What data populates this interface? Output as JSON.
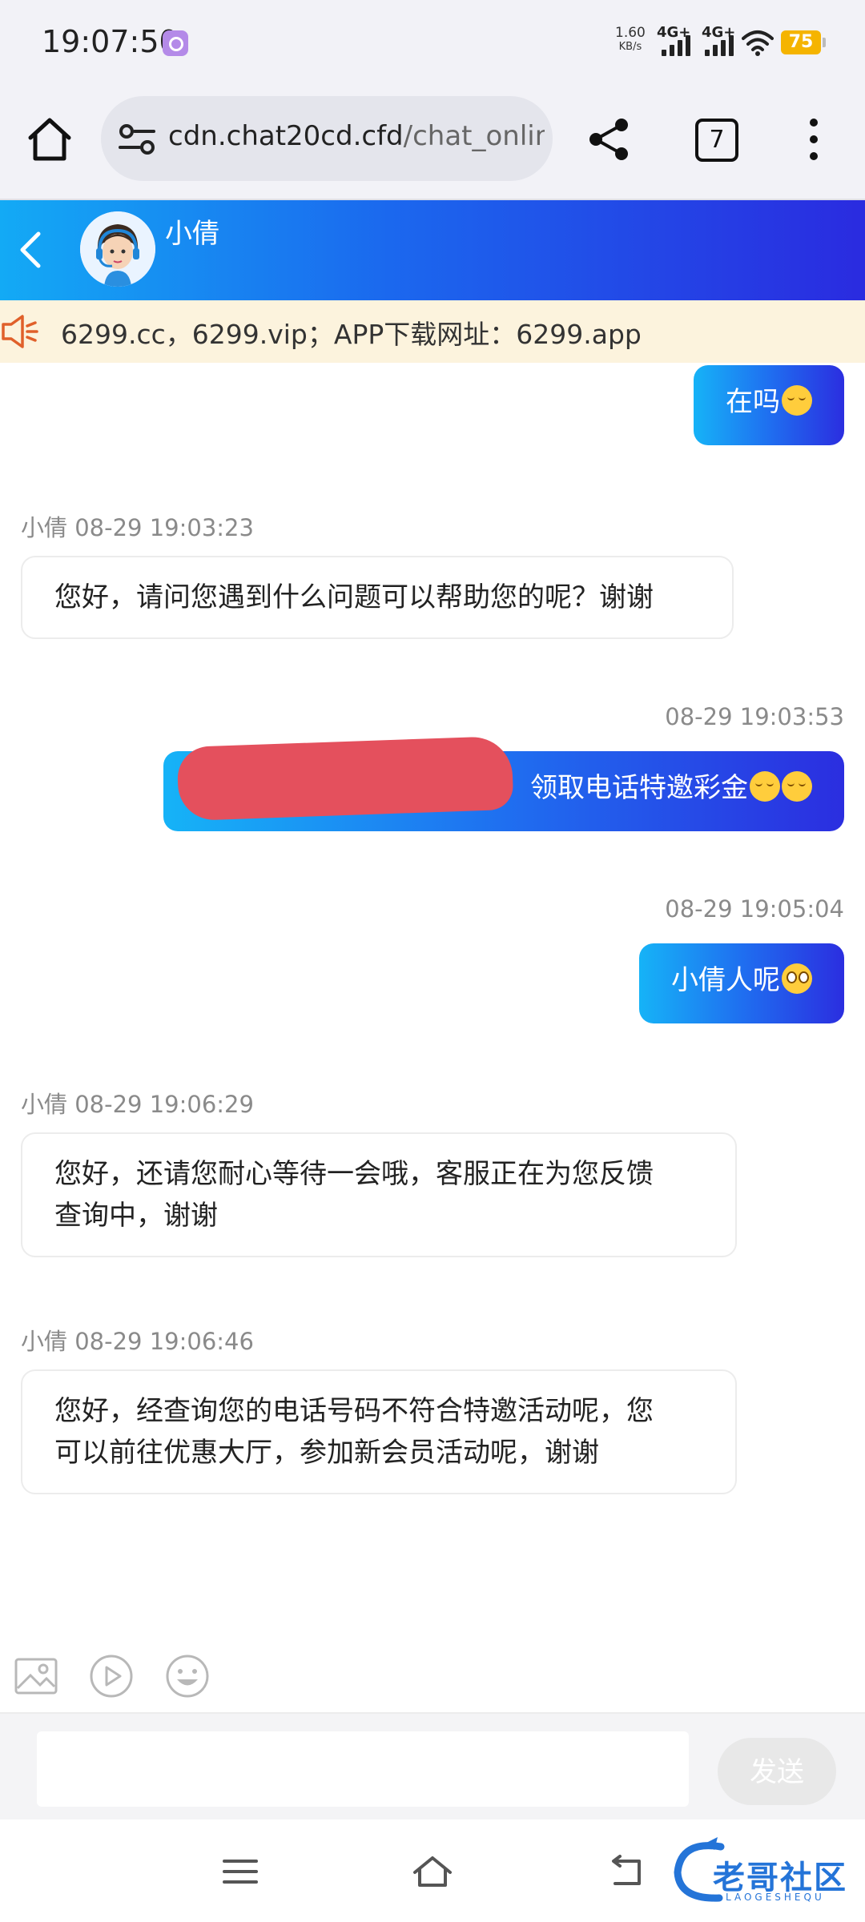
{
  "status_bar": {
    "time": "19:07:50",
    "speed_value": "1.60",
    "speed_unit": "KB/s",
    "net1": "4G+",
    "net2": "4G+",
    "battery": "75"
  },
  "browser": {
    "url_host": "cdn.chat20cd.cfd",
    "url_path": "/chat_online",
    "tab_count": "7"
  },
  "chat": {
    "agent_name": "小倩",
    "notice": "6299.cc，6299.vip；APP下载网址：6299.app",
    "messages": [
      {
        "dir": "out",
        "text": "在吗",
        "emoji": "relieved-face"
      },
      {
        "dir": "in",
        "meta": "小倩 08-29 19:03:23",
        "text": "您好，请问您遇到什么问题可以帮助您的呢？谢谢"
      },
      {
        "dir": "out",
        "meta": "08-29 19:03:53",
        "text": "领取电话特邀彩金",
        "emoji": "relieved-face"
      },
      {
        "dir": "out",
        "meta": "08-29 19:05:04",
        "text": "小倩人呢",
        "emoji": "flushed-face"
      },
      {
        "dir": "in",
        "meta": "小倩 08-29 19:06:29",
        "text_line1": "您好，还请您耐心等待一会哦，客服正在为您反馈",
        "text_line2": "查询中，谢谢"
      },
      {
        "dir": "in",
        "meta": "小倩 08-29 19:06:46",
        "text_line1": "您好，经查询您的电话号码不符合特邀活动呢，您",
        "text_line2": "可以前往优惠大厅，参加新会员活动呢，谢谢"
      }
    ]
  },
  "composer": {
    "input_value": "",
    "send_label": "发送"
  },
  "watermark": {
    "text": "老哥社区",
    "sub": "LAOGESHEQU"
  },
  "colors": {
    "header_gradient_start": "#13aaf5",
    "header_gradient_end": "#2a2be0",
    "notice_bg": "#fcf3dd",
    "redaction": "#e4505d"
  }
}
